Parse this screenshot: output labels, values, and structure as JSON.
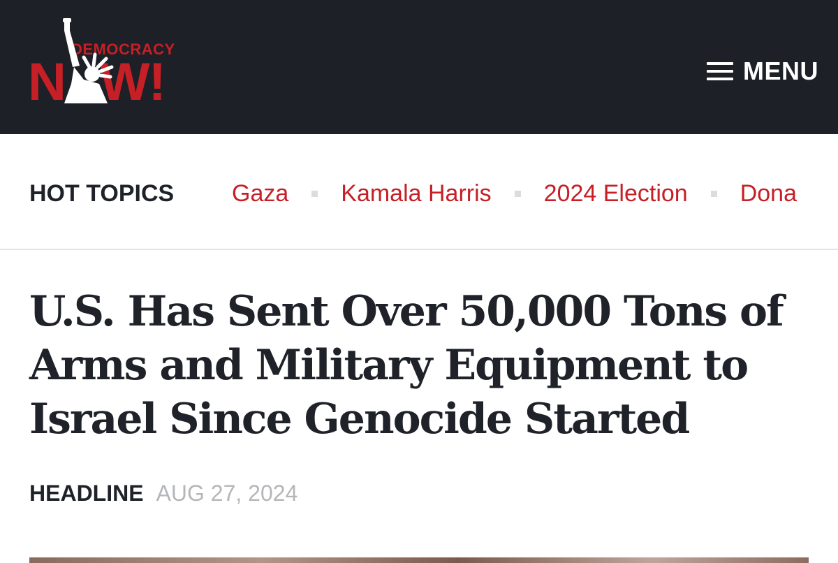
{
  "header": {
    "logo": {
      "top": "DEMOCRACY",
      "bottom_left": "N",
      "bottom_right": "W!"
    },
    "menu_label": "MENU"
  },
  "hot_topics": {
    "label": "HOT TOPICS",
    "items": [
      "Gaza",
      "Kamala Harris",
      "2024 Election",
      "Dona"
    ]
  },
  "article": {
    "title": "U.S. Has Sent Over 50,000 Tons of Arms and Military Equipment to Israel Since Genocide Started",
    "category": "HEADLINE",
    "date": "AUG 27, 2024"
  },
  "colors": {
    "brand_red": "#c61f26",
    "header_bg": "#1d2027",
    "text_dark": "#1f2229",
    "date_gray": "#b4b6ba"
  }
}
